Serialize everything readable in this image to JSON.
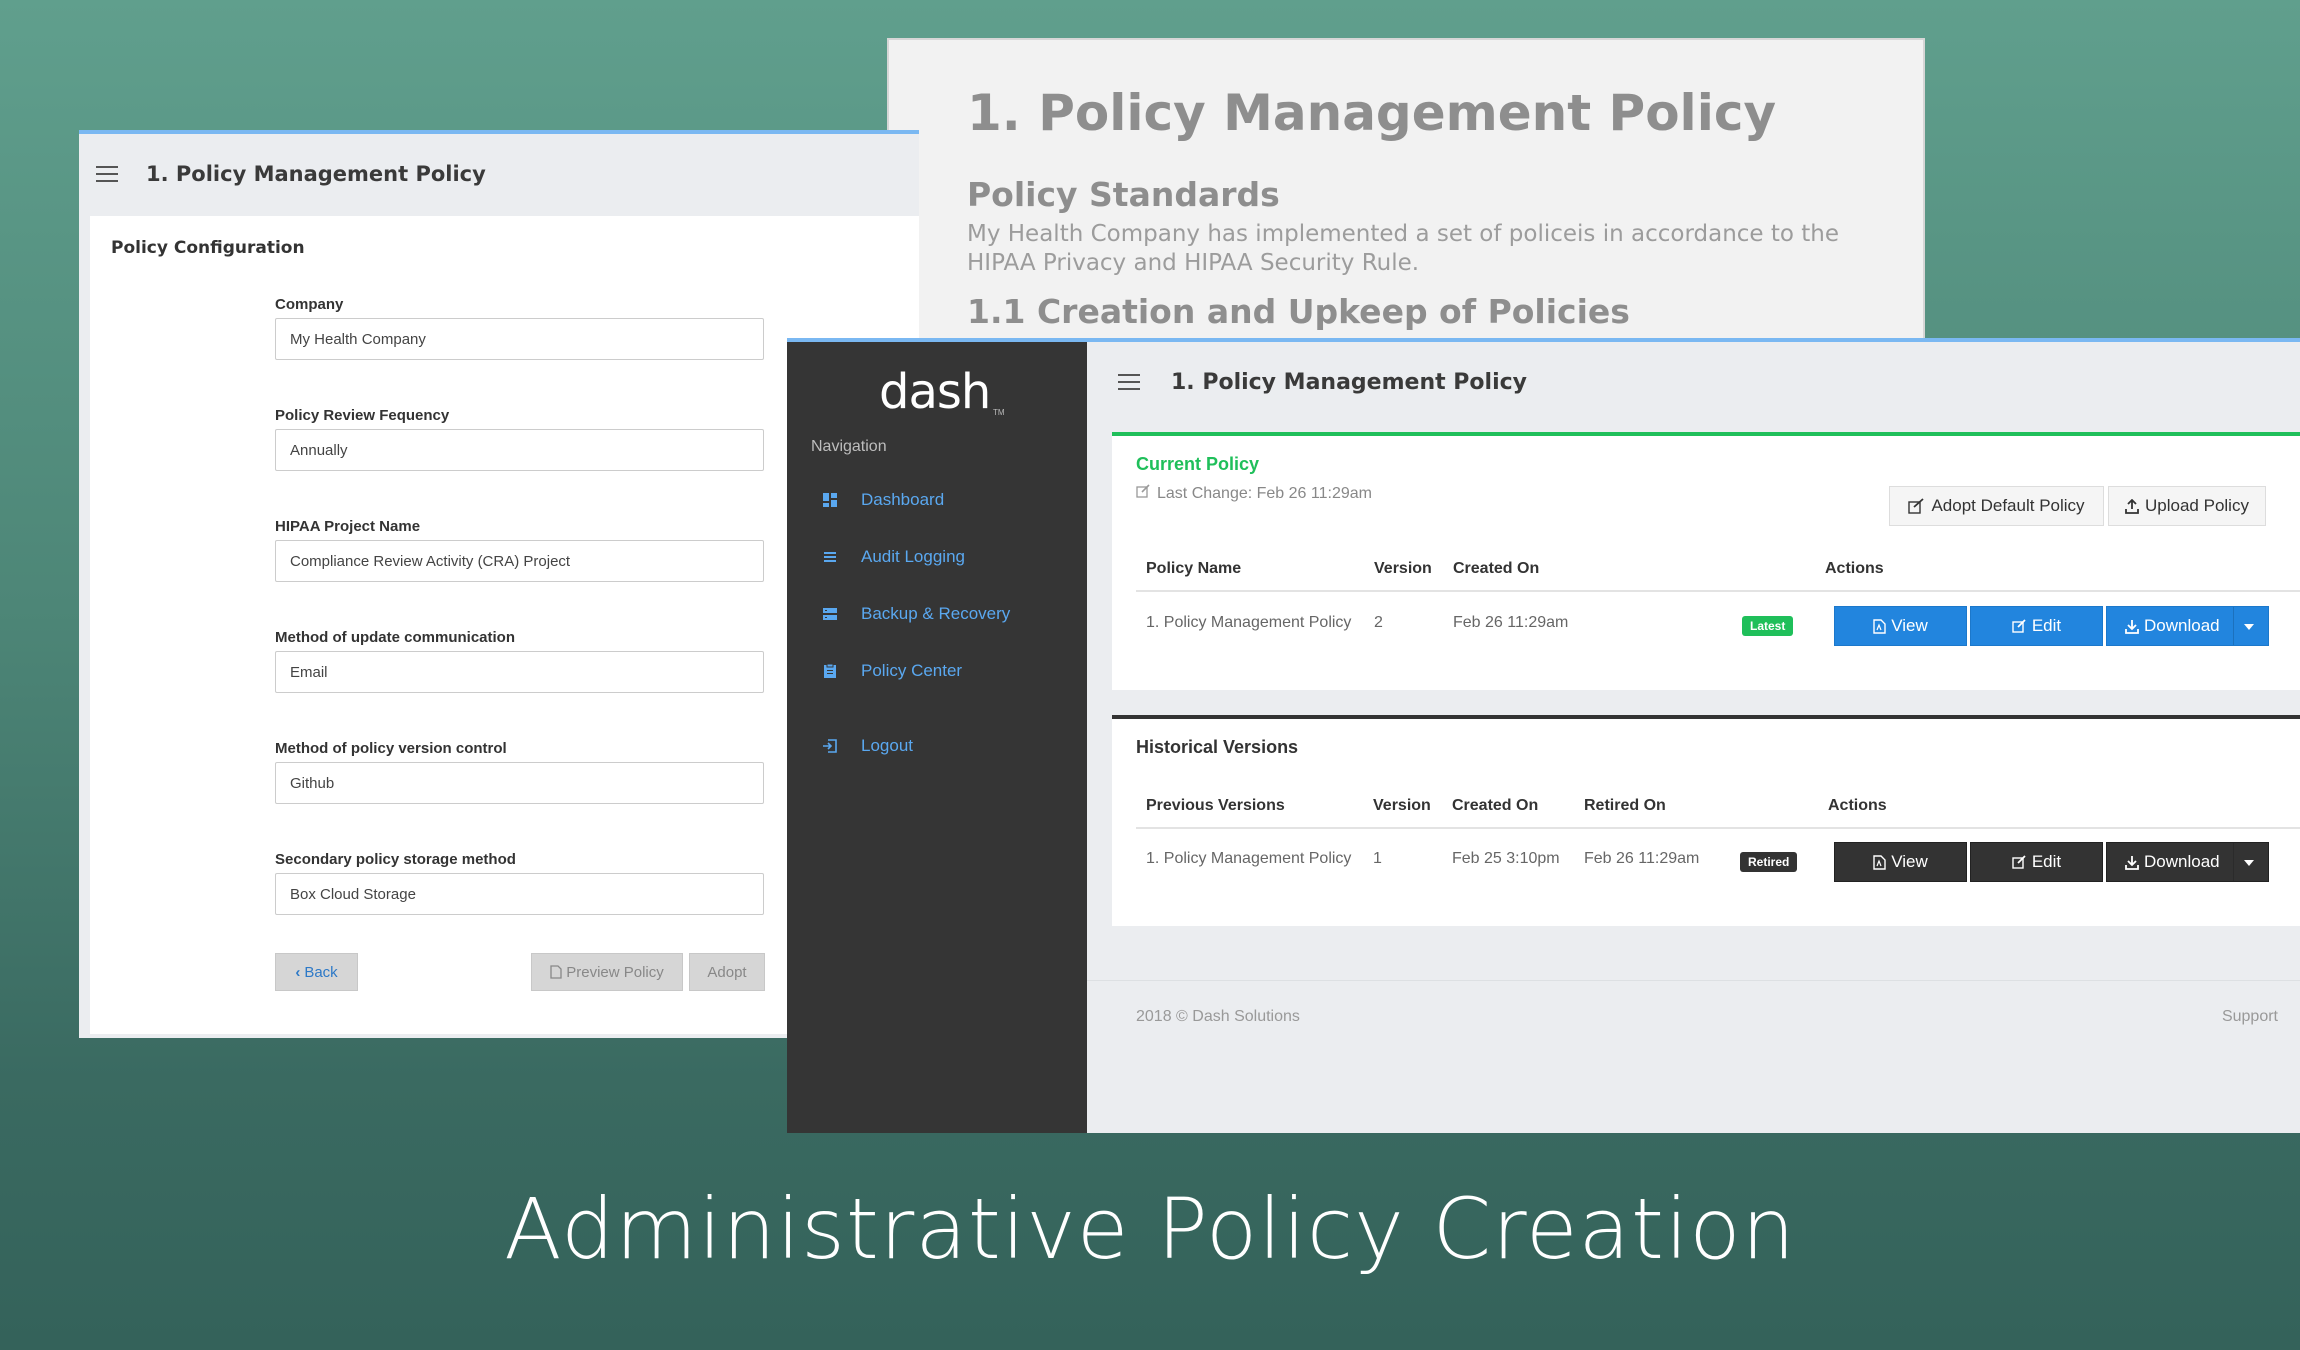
{
  "document_preview": {
    "heading": "1. Policy Management Policy",
    "subheading": "Policy Standards",
    "paragraph": "My Health Company has implemented a set of policeis in accordance to the HIPAA Privacy and HIPAA Security Rule.",
    "section": "1.1 Creation and Upkeep of Policies"
  },
  "config_window": {
    "title": "1. Policy Management Policy",
    "card_title": "Policy Configuration",
    "fields": [
      {
        "label": "Company",
        "value": "My Health Company"
      },
      {
        "label": "Policy Review Fequency",
        "value": "Annually"
      },
      {
        "label": "HIPAA Project Name",
        "value": "Compliance Review Activity (CRA) Project"
      },
      {
        "label": "Method of update communication",
        "value": "Email"
      },
      {
        "label": "Method of policy version control",
        "value": "Github"
      },
      {
        "label": "Secondary policy storage method",
        "value": "Box Cloud Storage"
      }
    ],
    "back_label": "Back",
    "preview_label": "Preview Policy",
    "adopt_label": "Adopt"
  },
  "app": {
    "logo": "dash",
    "logo_tm": "TM",
    "title": "1. Policy Management Policy",
    "nav_heading": "Navigation",
    "nav": [
      {
        "label": "Dashboard",
        "icon": "dashboard-icon"
      },
      {
        "label": "Audit Logging",
        "icon": "list-icon"
      },
      {
        "label": "Backup & Recovery",
        "icon": "server-icon"
      },
      {
        "label": "Policy Center",
        "icon": "clipboard-icon"
      },
      {
        "label": "Logout",
        "icon": "logout-icon"
      }
    ],
    "accent_color": "#2285de",
    "success_color": "#1fbf5a"
  },
  "current_policy": {
    "title": "Current Policy",
    "last_change": "Last Change: Feb 26 11:29am",
    "adopt_default_label": "Adopt Default Policy",
    "upload_label": "Upload Policy",
    "headers": [
      "Policy Name",
      "Version",
      "Created On",
      "Actions"
    ],
    "row": {
      "name": "1. Policy Management Policy",
      "version": "2",
      "created": "Feb 26 11:29am",
      "badge": "Latest"
    },
    "view_label": "View",
    "edit_label": "Edit",
    "download_label": "Download"
  },
  "historical": {
    "title": "Historical Versions",
    "headers": [
      "Previous Versions",
      "Version",
      "Created On",
      "Retired On",
      "Actions"
    ],
    "row": {
      "name": "1. Policy Management Policy",
      "version": "1",
      "created": "Feb 25 3:10pm",
      "retired": "Feb 26 11:29am",
      "badge": "Retired"
    },
    "view_label": "View",
    "edit_label": "Edit",
    "download_label": "Download"
  },
  "footer": {
    "copyright": "2018 © Dash Solutions",
    "support": "Support"
  },
  "caption": "Administrative Policy Creation"
}
